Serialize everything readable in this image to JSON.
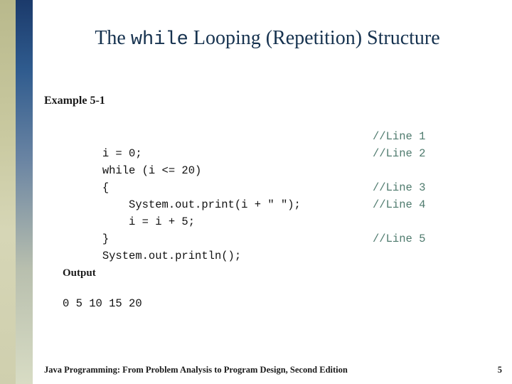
{
  "slide": {
    "title_prefix": "The ",
    "title_keyword": "while",
    "title_suffix": " Looping (Repetition) Structure",
    "example_label": "Example 5-1",
    "code_lines": [
      {
        "code": "i = 0;",
        "comment": "//Line 1"
      },
      {
        "code": "while (i <= 20)",
        "comment": "//Line 2"
      },
      {
        "code": "{",
        "comment": ""
      },
      {
        "code": "    System.out.print(i + \" \");",
        "comment": "//Line 3"
      },
      {
        "code": "    i = i + 5;",
        "comment": "//Line 4"
      },
      {
        "code": "}",
        "comment": ""
      },
      {
        "code": "System.out.println();",
        "comment": "//Line 5"
      }
    ],
    "output_label": "Output",
    "output_value": "0 5 10 15 20",
    "footer": "Java Programming: From Problem Analysis to Program Design, Second Edition",
    "page_number": "5"
  }
}
